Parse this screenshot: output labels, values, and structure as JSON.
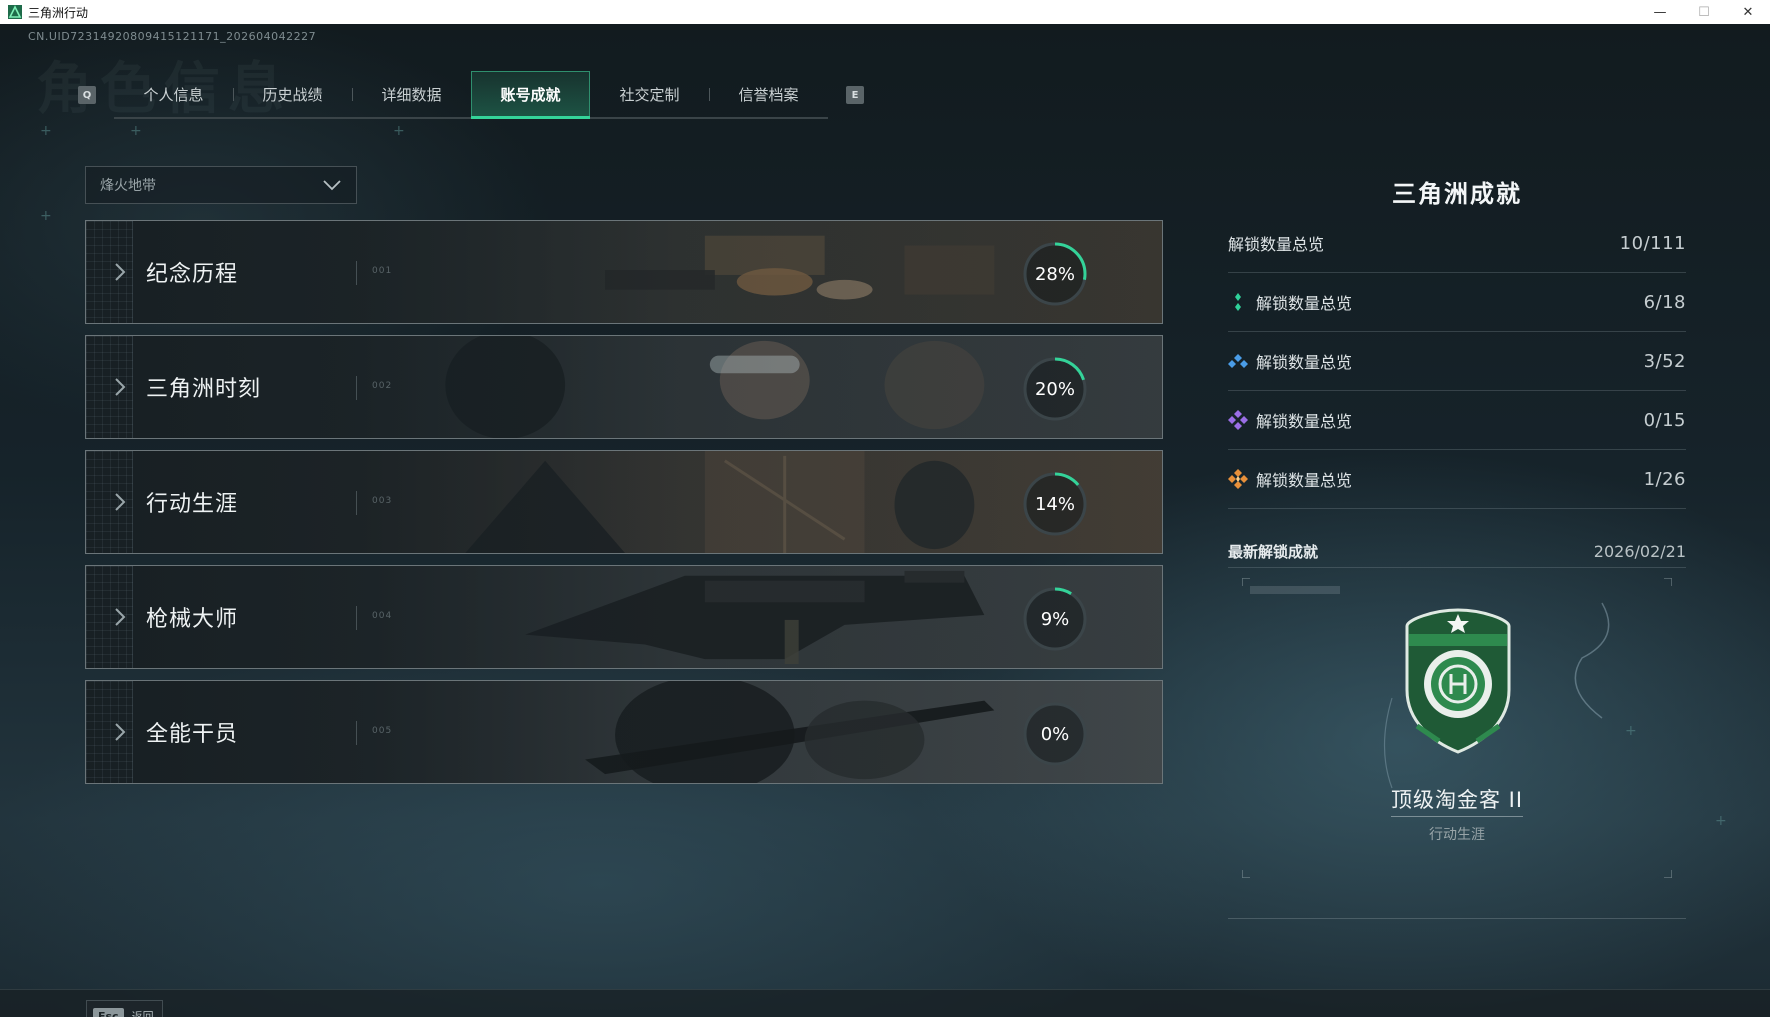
{
  "window": {
    "title": "三角洲行动",
    "controls": {
      "minimize": "—",
      "maximize": "☐",
      "close": "✕"
    }
  },
  "header": {
    "uid": "CN.UID7231492080941512117​1_202604042227",
    "background_title": "角色信息"
  },
  "tabs": {
    "prev_key": "Q",
    "next_key": "E",
    "items": [
      {
        "label": "个人信息",
        "active": false
      },
      {
        "label": "历史战绩",
        "active": false
      },
      {
        "label": "详细数据",
        "active": false
      },
      {
        "label": "账号成就",
        "active": true
      },
      {
        "label": "社交定制",
        "active": false
      },
      {
        "label": "信誉档案",
        "active": false
      }
    ]
  },
  "mode_select": {
    "value": "烽火地带"
  },
  "categories": [
    {
      "name": "纪念历程",
      "progress": 0.28,
      "label": "28%",
      "tag": "001",
      "art": "desk-items"
    },
    {
      "name": "三角洲时刻",
      "progress": 0.2,
      "label": "20%",
      "tag": "002",
      "art": "operators"
    },
    {
      "name": "行动生涯",
      "progress": 0.14,
      "label": "14%",
      "tag": "003",
      "art": "soldier-ruins"
    },
    {
      "name": "枪械大师",
      "progress": 0.09,
      "label": "9%",
      "tag": "004",
      "art": "machine-gun"
    },
    {
      "name": "全能干员",
      "progress": 0.0,
      "label": "0%",
      "tag": "005",
      "art": "sniper"
    }
  ],
  "summary": {
    "title": "三角洲成就",
    "total": {
      "label": "解锁数量总览",
      "value": "10/111"
    },
    "tiers": [
      {
        "label": "解锁数量总览",
        "value": "6/18",
        "icon": "green-tier-icon",
        "color": "#2fd19a"
      },
      {
        "label": "解锁数量总览",
        "value": "3/52",
        "icon": "blue-tier-icon",
        "color": "#4a9de8"
      },
      {
        "label": "解锁数量总览",
        "value": "0/15",
        "icon": "purple-tier-icon",
        "color": "#9a6ee6"
      },
      {
        "label": "解锁数量总览",
        "value": "1/26",
        "icon": "orange-tier-icon",
        "color": "#e8903a"
      }
    ]
  },
  "latest": {
    "label": "最新解锁成就",
    "date": "2026/02/21",
    "badge_name": "顶级淘金客 II",
    "badge_category": "行动生涯",
    "badge_color": "#2e8a4e"
  },
  "footer": {
    "esc_key": "Esc",
    "esc_label": "返回"
  },
  "colors": {
    "accent": "#34d399",
    "ring_track": "#3b4549"
  }
}
